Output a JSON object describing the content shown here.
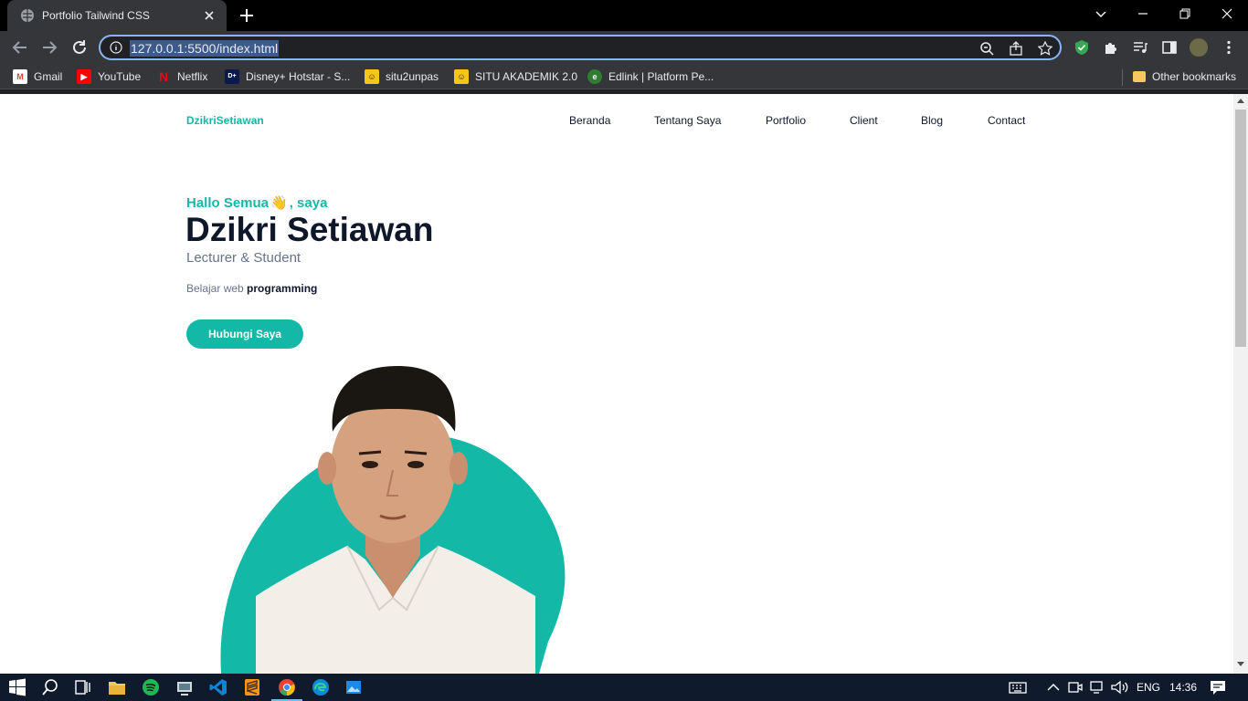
{
  "browser": {
    "tab_title": "Portfolio Tailwind CSS",
    "url": "127.0.0.1:5500/index.html",
    "bookmarks": [
      {
        "label": "Gmail",
        "icon": "gmail-icon",
        "color": "#ea4335"
      },
      {
        "label": "YouTube",
        "icon": "youtube-icon",
        "color": "#ff0000"
      },
      {
        "label": "Netflix",
        "icon": "netflix-icon",
        "color": "#e50914"
      },
      {
        "label": "Disney+ Hotstar - S...",
        "icon": "hotstar-icon",
        "color": "#0c1a4b"
      },
      {
        "label": "situ2unpas",
        "icon": "situ-icon",
        "color": "#f5c518"
      },
      {
        "label": "SITU AKADEMIK 2.0",
        "icon": "situ-akademik-icon",
        "color": "#f5c518"
      },
      {
        "label": "Edlink | Platform Pe...",
        "icon": "edlink-icon",
        "color": "#2e7d32"
      }
    ],
    "other_bookmarks": "Other bookmarks"
  },
  "page": {
    "brand": "DzikriSetiawan",
    "nav": [
      "Beranda",
      "Tentang Saya",
      "Portfolio",
      "Client",
      "Blog",
      "Contact"
    ],
    "greeting_prefix": "Hallo Semua",
    "greeting_emoji": "👋",
    "greeting_suffix": ", saya",
    "name": "Dzikri Setiawan",
    "role": "Lecturer & Student",
    "desc_prefix": "Belajar web ",
    "desc_bold": "programming",
    "cta": "Hubungi Saya",
    "accent": "#14b8a6"
  },
  "taskbar": {
    "lang": "ENG",
    "time": "14:36"
  }
}
